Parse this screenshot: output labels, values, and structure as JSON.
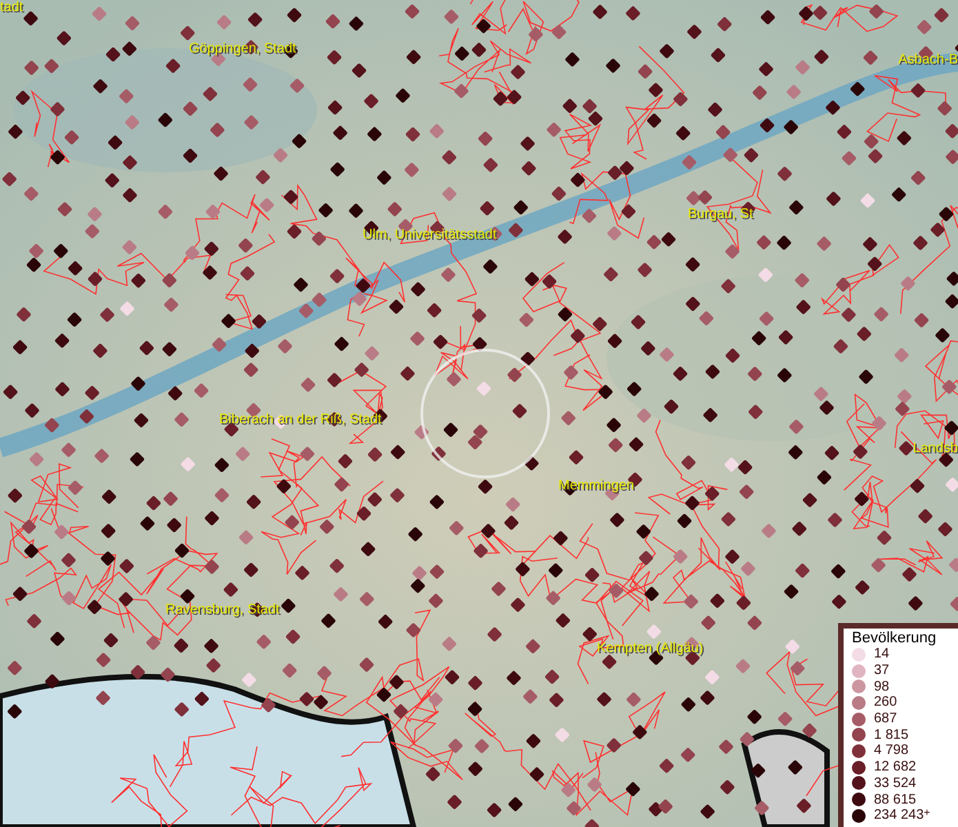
{
  "places": [
    {
      "name": "tadt"
    },
    {
      "name": "Göppingen, Stadt"
    },
    {
      "name": "Asbach-B"
    },
    {
      "name": "Burgau, St"
    },
    {
      "name": "Ulm, Universitätsstadt"
    },
    {
      "name": "Biberach an der Riß, Stadt"
    },
    {
      "name": "Landsb"
    },
    {
      "name": "Memmingen"
    },
    {
      "name": "Ravensburg, Stadt"
    },
    {
      "name": "Kempten (Allgäu)"
    }
  ],
  "legend": {
    "title": "Bevölkerung",
    "classes": [
      {
        "label": "14",
        "color": "#f3dce6"
      },
      {
        "label": "37",
        "color": "#e0b4c0"
      },
      {
        "label": "98",
        "color": "#cc96a0"
      },
      {
        "label": "260",
        "color": "#b97c86"
      },
      {
        "label": "687",
        "color": "#a65c66"
      },
      {
        "label": "1 815",
        "color": "#93444e"
      },
      {
        "label": "4 798",
        "color": "#7f303a"
      },
      {
        "label": "12 682",
        "color": "#6a1e28"
      },
      {
        "label": "33 524",
        "color": "#54121a"
      },
      {
        "label": "88 615",
        "color": "#3e0a10"
      },
      {
        "label": "234 243$^{+}$",
        "color": "#2a0508"
      }
    ]
  }
}
